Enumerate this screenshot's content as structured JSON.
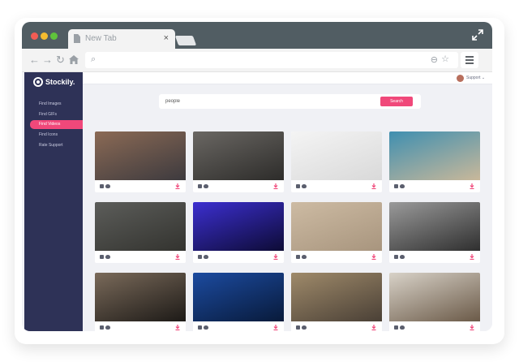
{
  "browser": {
    "tab_title": "New Tab",
    "tab_close": "×",
    "back_icon": "←",
    "forward_icon": "→",
    "reload_icon": "↻",
    "home_icon": "home-icon",
    "search_glyph": "⌕",
    "zoom_glyph": "⊖",
    "star_glyph": "☆"
  },
  "app": {
    "logo_text": "Stockily.",
    "sidebar": {
      "items": [
        {
          "label": "Find Images",
          "active": false
        },
        {
          "label": "Find GIFs",
          "active": false
        },
        {
          "label": "Find Videos",
          "active": true
        },
        {
          "label": "Find Icons",
          "active": false
        },
        {
          "label": "Rate Support",
          "active": false
        }
      ]
    },
    "topbar": {
      "support_label": "Support ⌄"
    },
    "search": {
      "value": "people",
      "button_label": "Search"
    },
    "results": [
      {
        "name": "phone-social-icons",
        "colors": [
          "#8b6a55",
          "#3d3a3e"
        ]
      },
      {
        "name": "group-sitting-feet",
        "colors": [
          "#6a6763",
          "#2d2c2a"
        ]
      },
      {
        "name": "desk-workspace-top-view",
        "colors": [
          "#f4f4f4",
          "#d9d9d9"
        ]
      },
      {
        "name": "aerial-coastline",
        "colors": [
          "#3f8fb0",
          "#c9b89a"
        ]
      },
      {
        "name": "street-bikes",
        "colors": [
          "#5c5d5a",
          "#33332f"
        ]
      },
      {
        "name": "concert-lights",
        "colors": [
          "#3c2fd0",
          "#0d0b35"
        ]
      },
      {
        "name": "desert-walk",
        "colors": [
          "#cdbba3",
          "#a8957e"
        ]
      },
      {
        "name": "city-street-bw",
        "colors": [
          "#9a9a9a",
          "#2f2f2f"
        ]
      },
      {
        "name": "dinner-table-bw",
        "colors": [
          "#7a6a5a",
          "#1d1a17"
        ]
      },
      {
        "name": "crowd-blue-stage",
        "colors": [
          "#1c4ba0",
          "#081a3a"
        ]
      },
      {
        "name": "city-crosswalk",
        "colors": [
          "#9f8a6a",
          "#4a4036"
        ]
      },
      {
        "name": "chess-hand",
        "colors": [
          "#d8d2c8",
          "#6b5a48"
        ]
      }
    ],
    "accent_color": "#f0487a",
    "sidebar_color": "#2e3257"
  }
}
